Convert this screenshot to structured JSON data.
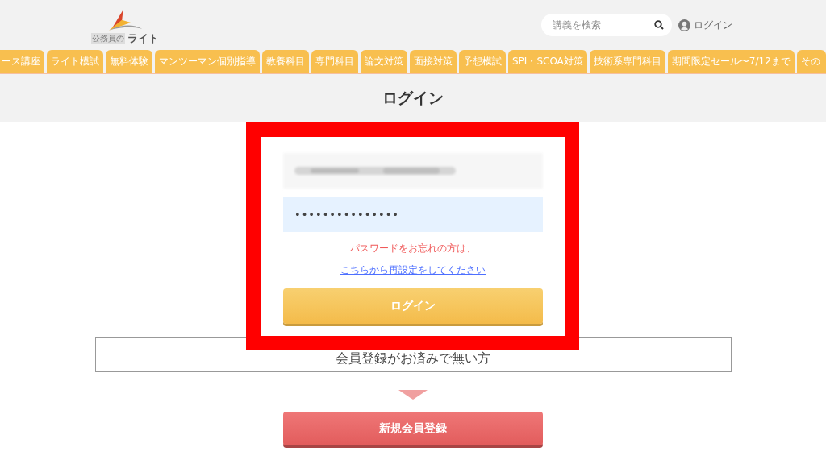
{
  "header": {
    "logo": {
      "small_text": "公務員の",
      "name": "ライト"
    },
    "search": {
      "placeholder": "講義を検索"
    },
    "login_link": "ログイン"
  },
  "nav_tabs": [
    {
      "label": "ース講座"
    },
    {
      "label": "ライト模試"
    },
    {
      "label": "無料体験"
    },
    {
      "label": "マンツーマン個別指導"
    },
    {
      "label": "教養科目"
    },
    {
      "label": "専門科目"
    },
    {
      "label": "論文対策"
    },
    {
      "label": "面接対策"
    },
    {
      "label": "予想模試"
    },
    {
      "label": "SPI・SCOA対策"
    },
    {
      "label": "技術系専門科目"
    },
    {
      "label": "期間限定セール〜7/12まで"
    },
    {
      "label": "その"
    }
  ],
  "page_title": "ログイン",
  "form": {
    "password": "•••••••••••••••",
    "forgot_text": "パスワードをお忘れの方は、",
    "reset_link": "こちらから再設定をしてください",
    "login_button": "ログイン"
  },
  "register": {
    "heading": "会員登録がお済みで無い方",
    "button": "新規会員登録"
  }
}
